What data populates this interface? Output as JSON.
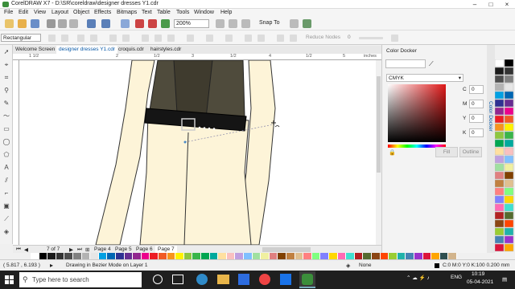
{
  "window": {
    "title": "CorelDRAW X7 - D:\\SR\\coreldraw\\designer dresses Y1.cdr"
  },
  "menu": [
    "File",
    "Edit",
    "View",
    "Layout",
    "Object",
    "Effects",
    "Bitmaps",
    "Text",
    "Table",
    "Tools",
    "Window",
    "Help"
  ],
  "toolbar": {
    "zoom": "200%",
    "snap_label": "Snap To"
  },
  "propertybar": {
    "shape": "Rectangular",
    "reduce_nodes": "Reduce Nodes",
    "node_count": "0"
  },
  "doc_tabs": [
    "Welcome Screen",
    "designer dresses Y1.cdr",
    "croquis.cdr",
    "hairstyles.cdr"
  ],
  "active_doc_tab": 1,
  "ruler": {
    "units": "inches",
    "marks": [
      "1 1/2",
      "2",
      "1/2",
      "3",
      "1/2",
      "4",
      "1/2",
      "5",
      "1/2"
    ]
  },
  "pages": {
    "counter": "7 of 7",
    "tabs": [
      "Page 4",
      "Page 5",
      "Page 6",
      "Page 7"
    ],
    "active": 3
  },
  "docker": {
    "title": "Color Docker",
    "model": "CMYK",
    "values": [
      {
        "label": "C",
        "value": "0"
      },
      {
        "label": "M",
        "value": "0"
      },
      {
        "label": "Y",
        "value": "0"
      },
      {
        "label": "K",
        "value": "0"
      }
    ],
    "fill_label": "Fill",
    "outline_label": "Outline",
    "side_tab": "Color Docker"
  },
  "status": {
    "coords": "( 5.817 , 6.193 )",
    "message": "Drawing in Bezier Mode on Layer 1",
    "fill_info": "None",
    "outline_info": "C:0 M:0 Y:0 K:100  0.200 mm"
  },
  "taskbar": {
    "search_placeholder": "Type here to search",
    "lang": "ENG",
    "time": "10:19",
    "date": "05-04-2021"
  },
  "palette_colors": [
    "#ffffff",
    "#000000",
    "#1a1a1a",
    "#333333",
    "#4d4d4d",
    "#808080",
    "#b3b3b3",
    "#e6e6e6",
    "#00a0e3",
    "#0066b3",
    "#2e3192",
    "#662d91",
    "#92278f",
    "#ec008c",
    "#ed1c24",
    "#f15a24",
    "#f7941d",
    "#fff200",
    "#8dc63f",
    "#39b54a",
    "#00a651",
    "#00a99d",
    "#ffe0a0",
    "#f9c0c0",
    "#c0a0e0",
    "#80c0ff",
    "#a0e0a0",
    "#f0f0a0",
    "#e08080",
    "#804000",
    "#c08040",
    "#e0c090",
    "#ff8080",
    "#80ff80",
    "#8080ff",
    "#ffd700",
    "#ff69b4",
    "#40e0d0",
    "#b22222",
    "#556b2f",
    "#8b4513",
    "#ff4500",
    "#9acd32",
    "#20b2aa",
    "#4682b4",
    "#9932cc",
    "#dc143c",
    "#ffa500",
    "#2f4f4f",
    "#d2b48c"
  ],
  "icons": [
    "coreldraw-logo-icon",
    "pick-tool-icon",
    "shape-tool-icon",
    "crop-icon",
    "zoom-icon",
    "freehand-icon",
    "rectangle-icon",
    "ellipse-icon",
    "polygon-icon",
    "text-icon",
    "parallel-icon",
    "connector-icon",
    "shadow-icon",
    "transparency-icon",
    "eyedropper-icon",
    "fill-icon",
    "outline-icon",
    "windows-start-icon",
    "search-icon",
    "lock-icon",
    "chevron-down-icon",
    "close-icon"
  ]
}
